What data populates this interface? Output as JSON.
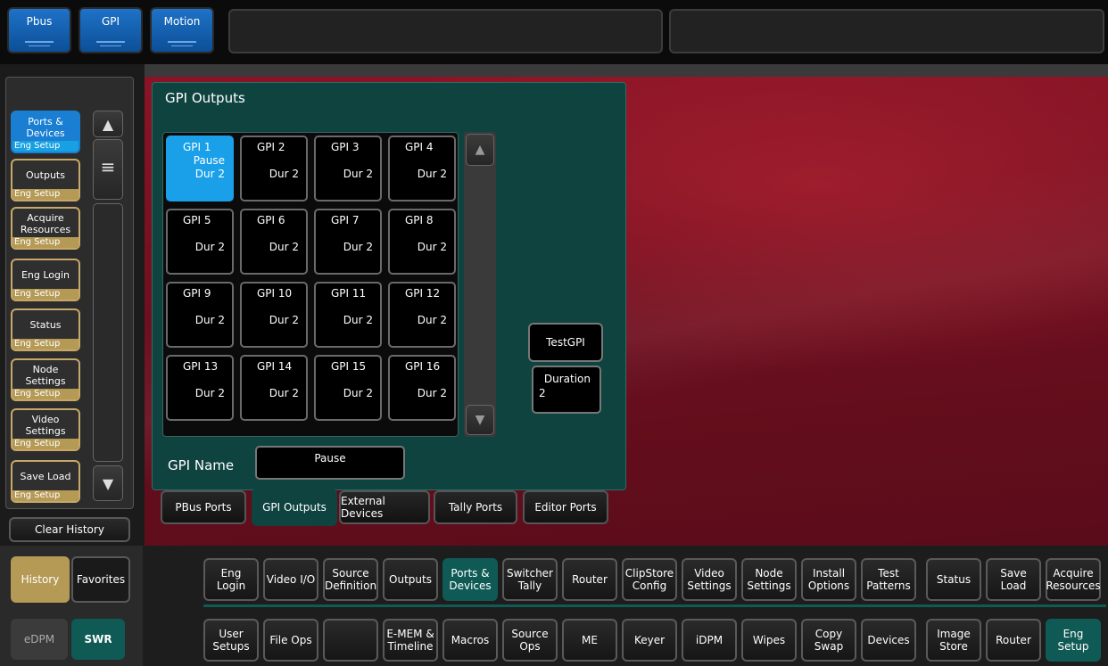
{
  "top_tabs": [
    "Pbus",
    "GPI",
    "Motion"
  ],
  "history": {
    "items": [
      {
        "label": "Ports & Devices",
        "category": "Eng Setup",
        "active": true
      },
      {
        "label": "Outputs",
        "category": "Eng Setup"
      },
      {
        "label": "Acquire Resources",
        "category": "Eng Setup"
      },
      {
        "label": "Eng Login",
        "category": "Eng Setup"
      },
      {
        "label": "Status",
        "category": "Eng Setup"
      },
      {
        "label": "Node Settings",
        "category": "Eng Setup"
      },
      {
        "label": "Video Settings",
        "category": "Eng Setup"
      },
      {
        "label": "Save Load",
        "category": "Eng Setup"
      }
    ],
    "clear_label": "Clear History",
    "tab_history": "History",
    "tab_favorites": "Favorites"
  },
  "gpi_panel": {
    "title": "GPI Outputs",
    "outputs": [
      {
        "name": "GPI 1",
        "state": "Pause",
        "dur": "Dur 2",
        "selected": true
      },
      {
        "name": "GPI 2",
        "state": "",
        "dur": "Dur 2"
      },
      {
        "name": "GPI 3",
        "state": "",
        "dur": "Dur 2"
      },
      {
        "name": "GPI 4",
        "state": "",
        "dur": "Dur 2"
      },
      {
        "name": "GPI 5",
        "state": "",
        "dur": "Dur 2"
      },
      {
        "name": "GPI 6",
        "state": "",
        "dur": "Dur 2"
      },
      {
        "name": "GPI 7",
        "state": "",
        "dur": "Dur 2"
      },
      {
        "name": "GPI 8",
        "state": "",
        "dur": "Dur 2"
      },
      {
        "name": "GPI 9",
        "state": "",
        "dur": "Dur 2"
      },
      {
        "name": "GPI 10",
        "state": "",
        "dur": "Dur 2"
      },
      {
        "name": "GPI 11",
        "state": "",
        "dur": "Dur 2"
      },
      {
        "name": "GPI 12",
        "state": "",
        "dur": "Dur 2"
      },
      {
        "name": "GPI 13",
        "state": "",
        "dur": "Dur 2"
      },
      {
        "name": "GPI 14",
        "state": "",
        "dur": "Dur 2"
      },
      {
        "name": "GPI 15",
        "state": "",
        "dur": "Dur 2"
      },
      {
        "name": "GPI 16",
        "state": "",
        "dur": "Dur 2"
      }
    ],
    "test_label": "TestGPI",
    "duration_label": "Duration",
    "duration_value": "2",
    "name_label": "GPI Name",
    "name_value": "Pause"
  },
  "sub_tabs": [
    {
      "label": "PBus Ports"
    },
    {
      "label": "GPI Outputs",
      "active": true
    },
    {
      "label": "External Devices"
    },
    {
      "label": "Tally Ports"
    },
    {
      "label": "Editor Ports"
    }
  ],
  "mode": {
    "edpm": "eDPM",
    "swr": "SWR"
  },
  "row1": [
    "Eng Login",
    "Video I/O",
    "Source Definition",
    "Outputs",
    "Ports & Devices",
    "Switcher Tally",
    "Router",
    "ClipStore Config",
    "Video Settings",
    "Node Settings",
    "Install Options",
    "Test Patterns",
    "Status",
    "Save Load",
    "Acquire Resources"
  ],
  "row2": [
    "User Setups",
    "File Ops",
    "",
    "E-MEM & Timeline",
    "Macros",
    "Source Ops",
    "ME",
    "Keyer",
    "iDPM",
    "Wipes",
    "Copy Swap",
    "Devices",
    "Image Store",
    "Router",
    "Eng Setup"
  ],
  "colors": {
    "accent_blue": "#1aa0e8",
    "teal": "#0f5a55",
    "panel": "#0e4340",
    "history_border": "#c8a869",
    "background_red": "#7a1222"
  }
}
